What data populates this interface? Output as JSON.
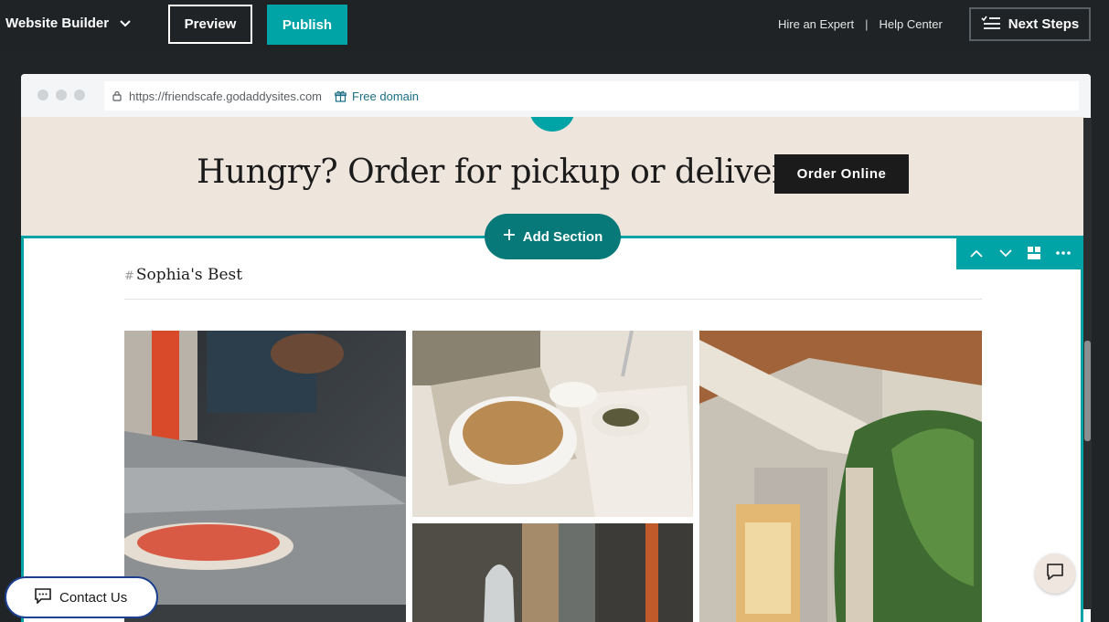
{
  "topbar": {
    "brand": "Website Builder",
    "preview_label": "Preview",
    "publish_label": "Publish",
    "hire_expert": "Hire an Expert",
    "separator": "|",
    "help_center": "Help Center",
    "next_steps": "Next Steps"
  },
  "browser": {
    "url": "https://friendscafe.godaddysites.com",
    "free_domain": "Free domain"
  },
  "hero": {
    "title": "Hungry? Order for pickup or delivery.",
    "order_button": "Order Online"
  },
  "section": {
    "add_section": "Add Section",
    "hash": "#",
    "title": "Sophia's Best"
  },
  "gallery": {
    "images": [
      "pizza-dough-image",
      "bread-basket-image",
      "patio-umbrella-image",
      "restaurant-interior-image"
    ]
  },
  "widgets": {
    "contact_us": "Contact Us"
  },
  "colors": {
    "accent": "#00a4a6",
    "accent_dark": "#077979",
    "topbar_bg": "#1f2326",
    "hero_bg": "#eee5dd"
  }
}
